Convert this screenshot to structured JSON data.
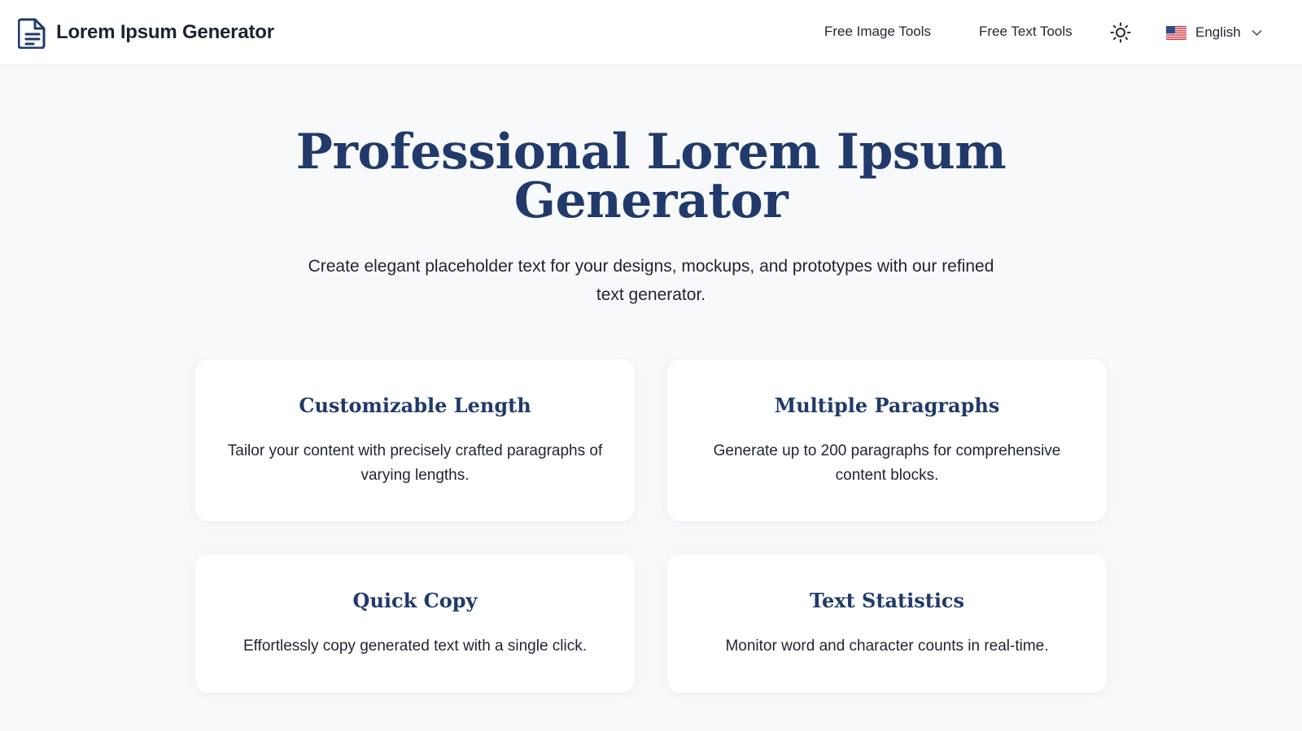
{
  "header": {
    "brand_title": "Lorem Ipsum Generator",
    "brand_icon": "document-icon",
    "nav": [
      {
        "label": "Free Image Tools"
      },
      {
        "label": "Free Text Tools"
      }
    ],
    "theme_icon": "sun-icon",
    "language": {
      "label": "English",
      "flag_icon": "us-flag-icon",
      "chevron_icon": "chevron-down-icon"
    }
  },
  "hero": {
    "title": "Professional Lorem Ipsum Generator",
    "subtitle": "Create elegant placeholder text for your designs, mockups, and prototypes with our refined text generator."
  },
  "features": [
    {
      "title": "Customizable Length",
      "description": "Tailor your content with precisely crafted paragraphs of varying lengths."
    },
    {
      "title": "Multiple Paragraphs",
      "description": "Generate up to 200 paragraphs for comprehensive content blocks."
    },
    {
      "title": "Quick Copy",
      "description": "Effortlessly copy generated text with a single click."
    },
    {
      "title": "Text Statistics",
      "description": "Monitor word and character counts in real-time."
    }
  ],
  "colors": {
    "accent": "#213a6b",
    "background": "#f8f9fb",
    "text": "#1f2430"
  }
}
